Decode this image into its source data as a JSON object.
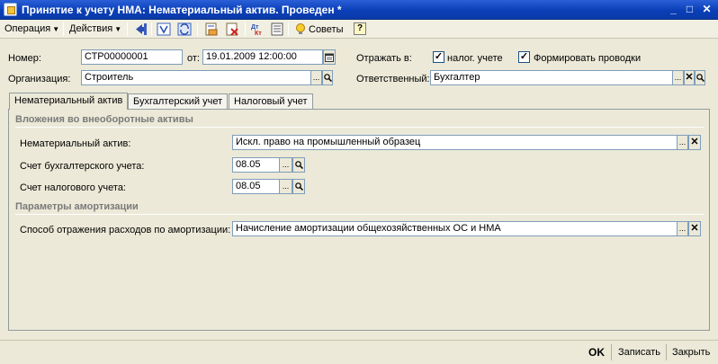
{
  "window": {
    "title": "Принятие к учету НМА: Нематериальный актив. Проведен *",
    "minimize": "_",
    "maximize": "□",
    "close": "✕"
  },
  "toolbar": {
    "operation_label": "Операция",
    "actions_label": "Действия",
    "tips_label": "Советы",
    "help_label": "?"
  },
  "header": {
    "number_label": "Номер:",
    "number_value": "СТР00000001",
    "date_label": "от:",
    "date_value": "19.01.2009 12:00:00",
    "org_label": "Организация:",
    "org_value": "Строитель",
    "reflect_label": "Отражать в:",
    "tax_check_label": "налог. учете",
    "tax_checked": true,
    "postings_check_label": "Формировать проводки",
    "postings_checked": true,
    "responsible_label": "Ответственный:",
    "responsible_value": "Бухгалтер"
  },
  "tabs": [
    {
      "label": "Нематериальный актив",
      "active": true
    },
    {
      "label": "Бухгалтерский учет",
      "active": false
    },
    {
      "label": "Налоговый учет",
      "active": false
    }
  ],
  "main": {
    "investments_title": "Вложения во внеоборотные активы",
    "asset_label": "Нематериальный актив:",
    "asset_value": "Искл. право на промышленный образец",
    "acc_account_label": "Счет бухгалтерского учета:",
    "acc_account_value": "08.05",
    "tax_account_label": "Счет налогового учета:",
    "tax_account_value": "08.05",
    "amort_title": "Параметры амортизации",
    "amort_method_label": "Способ отражения расходов по амортизации:",
    "amort_method_value": "Начисление амортизации общехозяйственных ОС и НМА"
  },
  "footer": {
    "ok_label": "OK",
    "save_label": "Записать",
    "close_label": "Закрыть"
  },
  "colors": {
    "titlebar": "#0a3fb8",
    "background": "#ece9d8",
    "field_border": "#7f9db9"
  }
}
